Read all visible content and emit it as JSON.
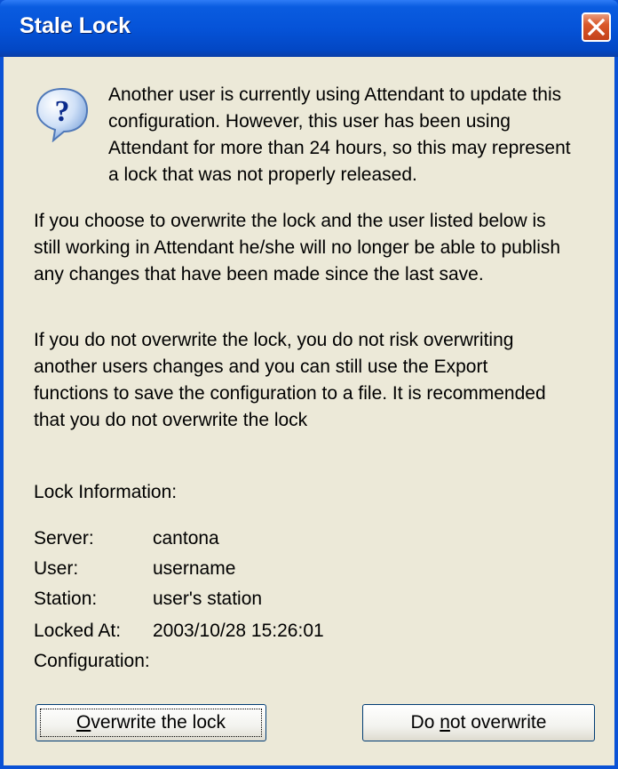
{
  "window": {
    "title": "Stale Lock",
    "close_icon": "close-icon"
  },
  "message": {
    "icon": "question-icon",
    "intro": "Another user is currently using Attendant to update this\nconfiguration.  However, this user has been using\nAttendant for more than 24 hours, so this may represent\na lock that was not properly released.",
    "paragraph2": "If you choose to overwrite the lock and the user listed below is\nstill working in Attendant he/she will no longer be able to publish\nany changes that have been made since the last save.",
    "paragraph3": "If you do not overwrite the lock, you do not risk overwriting\nanother users changes and you can still use the Export\nfunctions to save the configuration to a file.  It is recommended\nthat you do not overwrite the lock"
  },
  "lock_info": {
    "heading": "Lock Information:",
    "fields": [
      {
        "label": "Server:",
        "value": "cantona"
      },
      {
        "label": "User:",
        "value": "username"
      },
      {
        "label": "Station:",
        "value": "user's station"
      },
      {
        "label": "Locked At:",
        "value": "2003/10/28 15:26:01"
      },
      {
        "label": "Configuration:",
        "value": ""
      }
    ]
  },
  "buttons": {
    "overwrite": {
      "accel": "O",
      "rest": "verwrite the lock"
    },
    "do_not": {
      "pre": "Do ",
      "accel": "n",
      "rest": "ot overwrite"
    }
  }
}
